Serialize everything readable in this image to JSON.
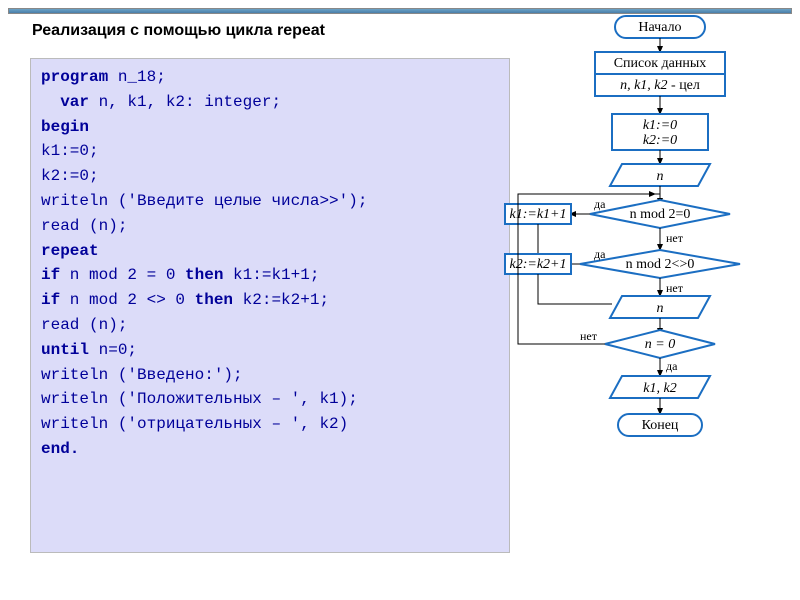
{
  "heading": "Реализация с помощью цикла repeat",
  "code": {
    "l1a": "program",
    "l1b": " n_18;",
    "l2a": "var",
    "l2b": " n, k1, k2: integer;",
    "l3": "begin",
    "l4": "   k1:=0;",
    "l5": "   k2:=0;",
    "l6": "   writeln ('Введите целые числа>>');",
    "l7": "   read (n);",
    "l8": "   repeat",
    "l9a": "     if",
    "l9b": " n mod 2 = 0 ",
    "l9c": "then",
    "l9d": " k1:=k1+1;",
    "l10a": "     if",
    "l10b": " n mod 2 <> 0 ",
    "l10c": "then",
    "l10d": " k2:=k2+1;",
    "l11": "     read (n);",
    "l12a": "   until",
    "l12b": " n=0;",
    "l13": "   writeln ('Введено:');",
    "l14": "   writeln ('Положительных – ', k1);",
    "l15": "   writeln ('отрицательных – ', k2)",
    "l16": "end."
  },
  "flow": {
    "start": "Начало",
    "data": "Список данных",
    "vars": "n, k1, k2",
    "vars_suffix": " - цел",
    "init1": "k1:=0",
    "init2": "k2:=0",
    "in1": "n",
    "c1": "n mod 2=0",
    "a1": "k1:=k1+1",
    "c2": "n mod 2<>0",
    "a2": "k2:=k2+1",
    "in2": "n",
    "c3": "n = 0",
    "out": "k1, k2",
    "end": "Конец",
    "yes": "да",
    "no": "нет"
  }
}
